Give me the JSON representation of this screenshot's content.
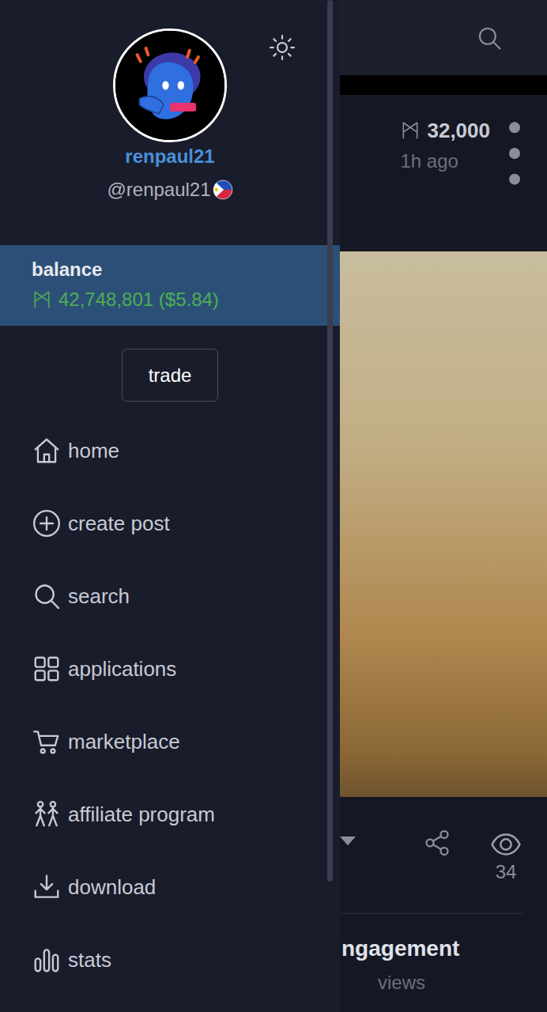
{
  "drawer": {
    "profile": {
      "display_name": "renpaul21",
      "handle": "@renpaul21"
    },
    "balance": {
      "label": "balance",
      "amount": "42,748,801 ($5.84)",
      "highlighted": true
    },
    "trade_button": "trade",
    "menu": [
      {
        "label": "home",
        "selected": false
      },
      {
        "label": "create post",
        "selected": false
      },
      {
        "label": "search",
        "selected": false
      },
      {
        "label": "applications",
        "selected": false
      },
      {
        "label": "marketplace",
        "selected": false
      },
      {
        "label": "affiliate program",
        "selected": false
      },
      {
        "label": "download",
        "selected": false
      },
      {
        "label": "stats",
        "selected": false
      }
    ]
  },
  "feed": {
    "post": {
      "amount": "32,000",
      "time": "1h ago",
      "views": "34"
    },
    "section": {
      "title": "ngagement",
      "subtitle": "views"
    }
  }
}
